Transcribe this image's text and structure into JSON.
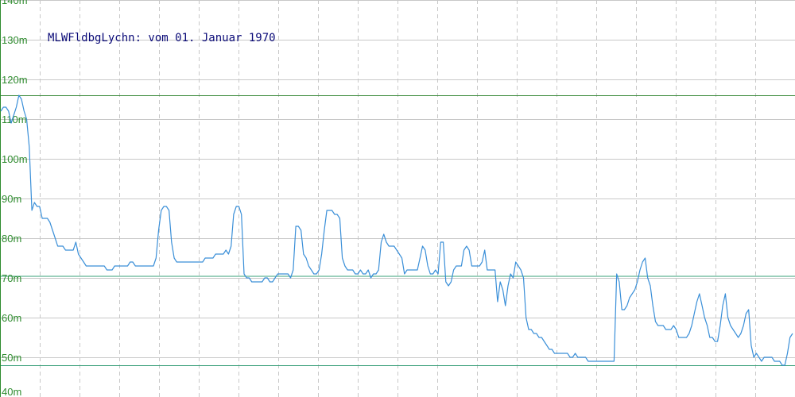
{
  "chart_data": {
    "type": "line",
    "title": "MLWFldbgLychn: vom 01. Januar 1970",
    "xlabel": "",
    "ylabel": "",
    "ylim": [
      40,
      140
    ],
    "y_ticks": [
      {
        "value": 140,
        "label": "140m"
      },
      {
        "value": 130,
        "label": "130m"
      },
      {
        "value": 120,
        "label": "120m"
      },
      {
        "value": 110,
        "label": "110m"
      },
      {
        "value": 100,
        "label": "100m"
      },
      {
        "value": 90,
        "label": "90m"
      },
      {
        "value": 80,
        "label": "80m"
      },
      {
        "value": 70,
        "label": "70m"
      },
      {
        "value": 60,
        "label": "60m"
      },
      {
        "value": 50,
        "label": "50m"
      },
      {
        "value": 40,
        "label": "40m"
      }
    ],
    "grid": true,
    "reference_lines": [
      {
        "value": 116,
        "color": "#3a8a3a"
      },
      {
        "value": 70.5,
        "color": "#3aa07a"
      },
      {
        "value": 48,
        "color": "#3aa07a"
      }
    ],
    "series": [
      {
        "color": "#3a8fd8",
        "values": [
          112,
          113,
          113,
          112,
          109,
          111,
          113,
          116,
          115,
          112,
          110,
          103,
          87,
          89,
          88,
          88,
          85,
          85,
          85,
          84,
          82,
          80,
          78,
          78,
          78,
          77,
          77,
          77,
          77,
          79,
          76,
          75,
          74,
          73,
          73,
          73,
          73,
          73,
          73,
          73,
          73,
          72,
          72,
          72,
          73,
          73,
          73,
          73,
          73,
          73,
          74,
          74,
          73,
          73,
          73,
          73,
          73,
          73,
          73,
          73,
          75,
          82,
          87,
          88,
          88,
          87,
          79,
          75,
          74,
          74,
          74,
          74,
          74,
          74,
          74,
          74,
          74,
          74,
          74,
          75,
          75,
          75,
          75,
          76,
          76,
          76,
          76,
          77,
          76,
          78,
          86,
          88,
          88,
          86,
          71,
          70,
          70,
          69,
          69,
          69,
          69,
          69,
          70,
          70,
          69,
          69,
          70,
          71,
          71,
          71,
          71,
          71,
          70,
          72,
          83,
          83,
          82,
          76,
          75,
          73,
          72,
          71,
          71,
          72,
          76,
          82,
          87,
          87,
          87,
          86,
          86,
          85,
          75,
          73,
          72,
          72,
          72,
          71,
          71,
          72,
          71,
          71,
          72,
          70,
          71,
          71,
          72,
          79,
          81,
          79,
          78,
          78,
          78,
          77,
          76,
          75,
          71,
          72,
          72,
          72,
          72,
          72,
          75,
          78,
          77,
          73,
          71,
          71,
          72,
          71,
          79,
          79,
          69,
          68,
          69,
          72,
          73,
          73,
          73,
          77,
          78,
          77,
          73,
          73,
          73,
          73,
          74,
          77,
          72,
          72,
          72,
          72,
          64,
          69,
          67,
          63,
          68,
          71,
          70,
          74,
          73,
          72,
          70,
          60,
          57,
          57,
          56,
          56,
          55,
          55,
          54,
          53,
          52,
          52,
          51,
          51,
          51,
          51,
          51,
          51,
          50,
          50,
          51,
          50,
          50,
          50,
          50,
          49,
          49,
          49,
          49,
          49,
          49,
          49,
          49,
          49,
          49,
          49,
          71,
          69,
          62,
          62,
          63,
          65,
          66,
          67,
          69,
          72,
          74,
          75,
          70,
          68,
          63,
          59,
          58,
          58,
          58,
          57,
          57,
          57,
          58,
          57,
          55,
          55,
          55,
          55,
          56,
          58,
          61,
          64,
          66,
          63,
          60,
          58,
          55,
          55,
          54,
          54,
          58,
          63,
          66,
          60,
          58,
          57,
          56,
          55,
          56,
          58,
          61,
          62,
          53,
          50,
          51,
          50,
          49,
          50,
          50,
          50,
          50,
          49,
          49,
          49,
          48,
          48,
          51,
          55,
          56
        ]
      }
    ]
  }
}
